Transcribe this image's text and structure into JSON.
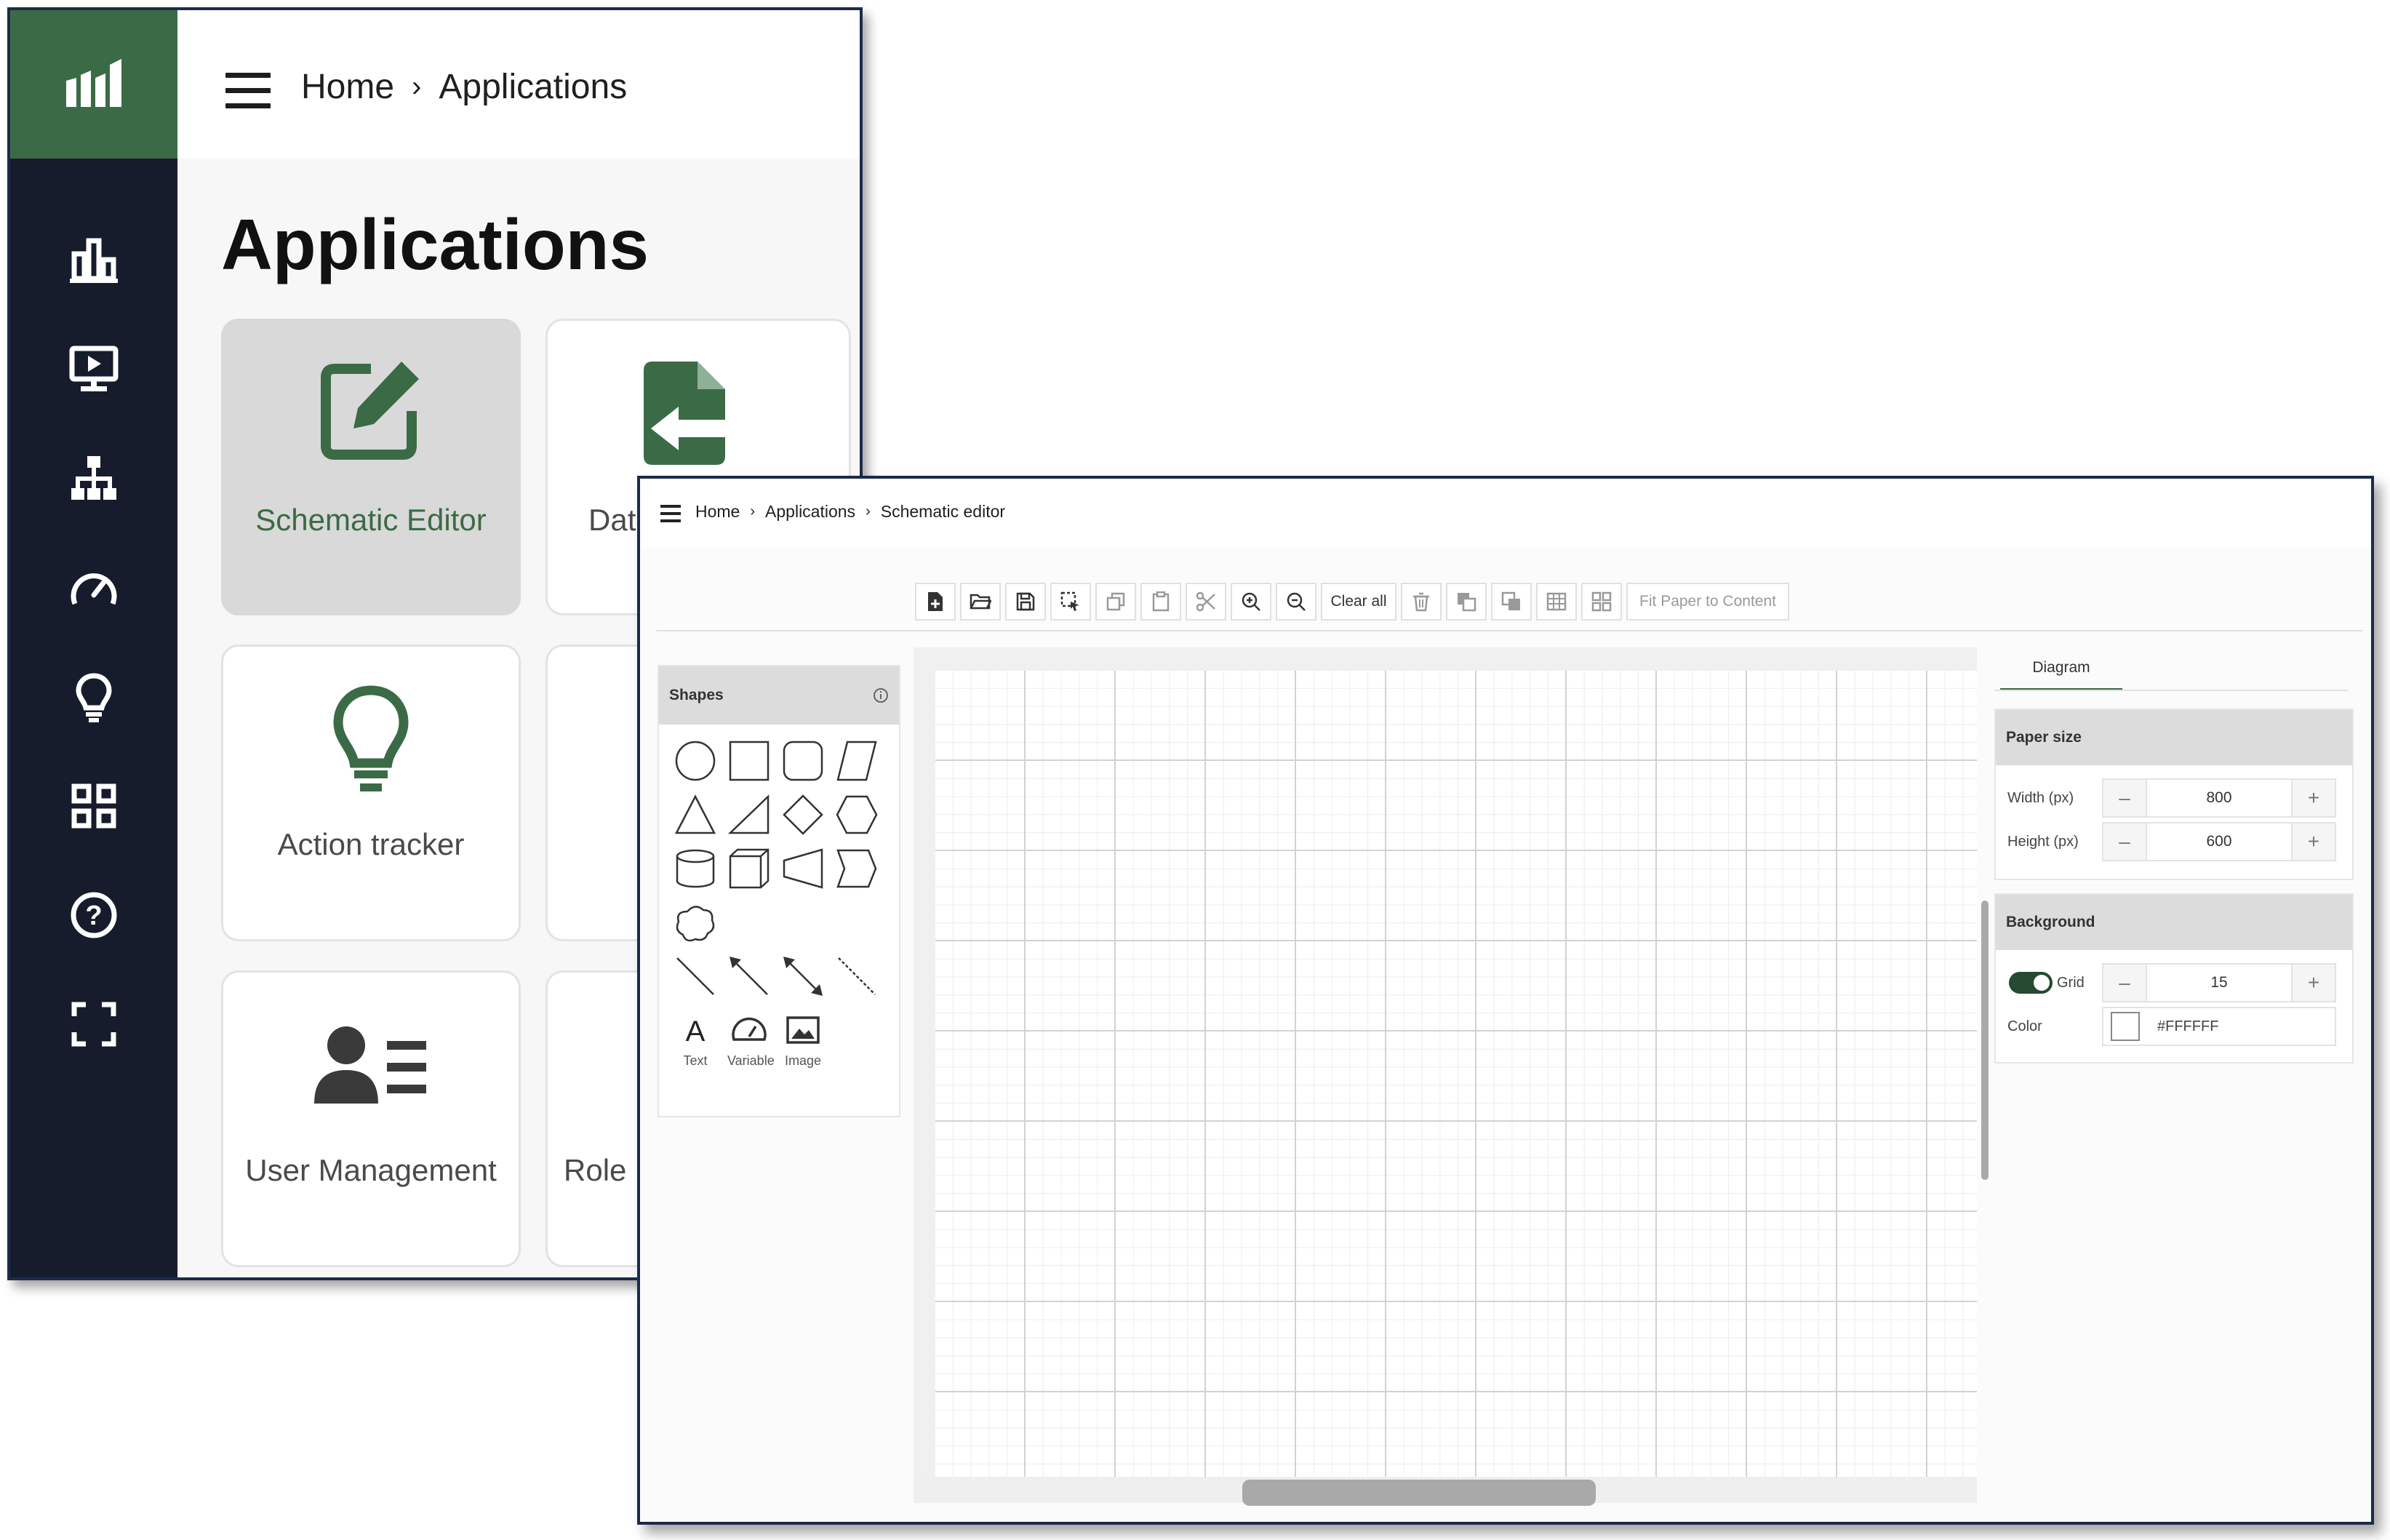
{
  "back_window": {
    "breadcrumb": [
      "Home",
      "Applications"
    ],
    "breadcrumb_separator": "›",
    "page_title": "Applications",
    "rail_icons": [
      "bar-chart-icon",
      "monitor-play-icon",
      "hierarchy-icon",
      "gauge-icon",
      "lightbulb-icon",
      "grid-icon",
      "help-icon",
      "fullscreen-icon"
    ],
    "cards": [
      {
        "label": "Schematic Editor",
        "icon": "edit-icon",
        "active": true
      },
      {
        "label": "Dat",
        "icon": "file-export-icon"
      },
      {
        "label": "Action tracker",
        "icon": "lightbulb-icon"
      },
      {
        "label": "",
        "icon": ""
      },
      {
        "label": "User Management",
        "icon": "user-list-icon"
      },
      {
        "label": "Role",
        "icon": ""
      }
    ],
    "colors": {
      "brand": "#3b6b46",
      "rail": "#161c2c"
    }
  },
  "front_window": {
    "breadcrumb": [
      "Home",
      "Applications",
      "Schematic editor"
    ],
    "breadcrumb_separator": "›",
    "toolbar": {
      "buttons": [
        "new-file-icon",
        "open-folder-icon",
        "save-icon",
        "select-icon",
        "copy-icon",
        "paste-icon",
        "cut-icon",
        "zoom-in-icon",
        "zoom-out-icon"
      ],
      "clear_all": "Clear all",
      "buttons2": [
        "delete-icon",
        "send-back-icon",
        "bring-front-icon",
        "table-icon",
        "group-icon"
      ],
      "fit_paper": "Fit Paper to Content"
    },
    "shapes_panel": {
      "title": "Shapes",
      "tools": [
        "Text",
        "Variable",
        "Image"
      ]
    },
    "right_panel": {
      "tab": "Diagram",
      "paper_size": {
        "title": "Paper size",
        "width_label": "Width (px)",
        "width_value": "800",
        "height_label": "Height (px)",
        "height_value": "600",
        "minus": "–",
        "plus": "+"
      },
      "background": {
        "title": "Background",
        "grid_label": "Grid",
        "grid_value": "15",
        "grid_enabled": true,
        "color_label": "Color",
        "color_value": "#FFFFFF"
      }
    }
  }
}
